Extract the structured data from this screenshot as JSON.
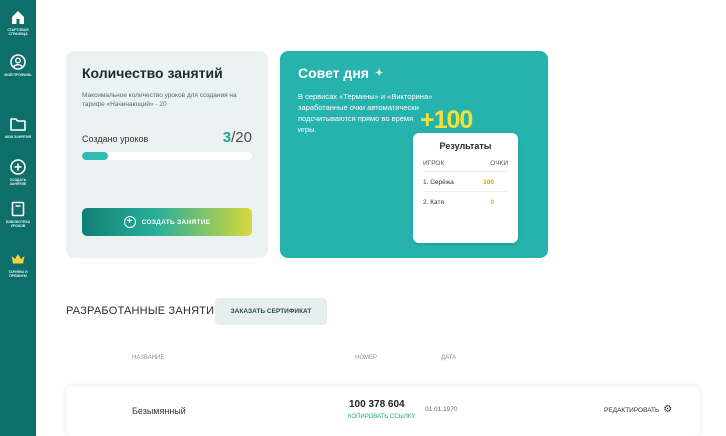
{
  "sidebar": {
    "items": [
      {
        "label": "СТАРТОВАЯ СТРАНИЦА",
        "icon": "home-icon"
      },
      {
        "label": "МОЙ ПРОФИЛЬ",
        "icon": "profile-icon"
      },
      {
        "label": "МОИ ЗАНЯТИЯ",
        "icon": "folder-icon"
      },
      {
        "label": "СОЗДАТЬ ЗАНЯТИЕ",
        "icon": "plus-circle-icon"
      },
      {
        "label": "БИБЛИОТЕКА УРОКОВ",
        "icon": "library-icon"
      },
      {
        "label": "ТАРИФЫ И ПРЕМИУМ",
        "icon": "crown-icon"
      }
    ]
  },
  "lessons_card": {
    "title": "Количество занятий",
    "description": "Максимальное количество уроков для создания на тарифе «Начинающий» - 20",
    "created_label": "Создано уроков",
    "created_count": "3",
    "created_max": "/20",
    "progress_percent": 15,
    "create_button": "СОЗДАТЬ ЗАНЯТИЕ"
  },
  "tip_card": {
    "title": "Совет дня",
    "text": "В сервисах «Термины» и «Викторина» заработанные очки автоматически подсчитываются прямо во время игры.",
    "bonus": "+100"
  },
  "results": {
    "title": "Результаты",
    "col_player": "ИГРОК",
    "col_points": "ОЧКИ",
    "rows": [
      {
        "player": "1. Серёжа",
        "points": "100"
      },
      {
        "player": "2. Катя",
        "points": "0"
      }
    ]
  },
  "section": {
    "title": "РАЗРАБОТАННЫЕ ЗАНЯТИЯ",
    "cert_button": "ЗАКАЗАТЬ СЕРТИФИКАТ",
    "col_name": "НАЗВАНИЕ",
    "col_number": "НОМЕР",
    "col_date": "ДАТА"
  },
  "lesson_row": {
    "name": "Безымянный",
    "number": "100 378 604",
    "copy_link": "КОПИРОВАТЬ ССЫЛКУ",
    "date": "01.01.1970",
    "edit": "РЕДАКТИРОВАТЬ"
  },
  "colors": {
    "sidebar": "#0e6f6a",
    "accent": "#26b3ad",
    "bonus_yellow": "#f3e13a"
  }
}
